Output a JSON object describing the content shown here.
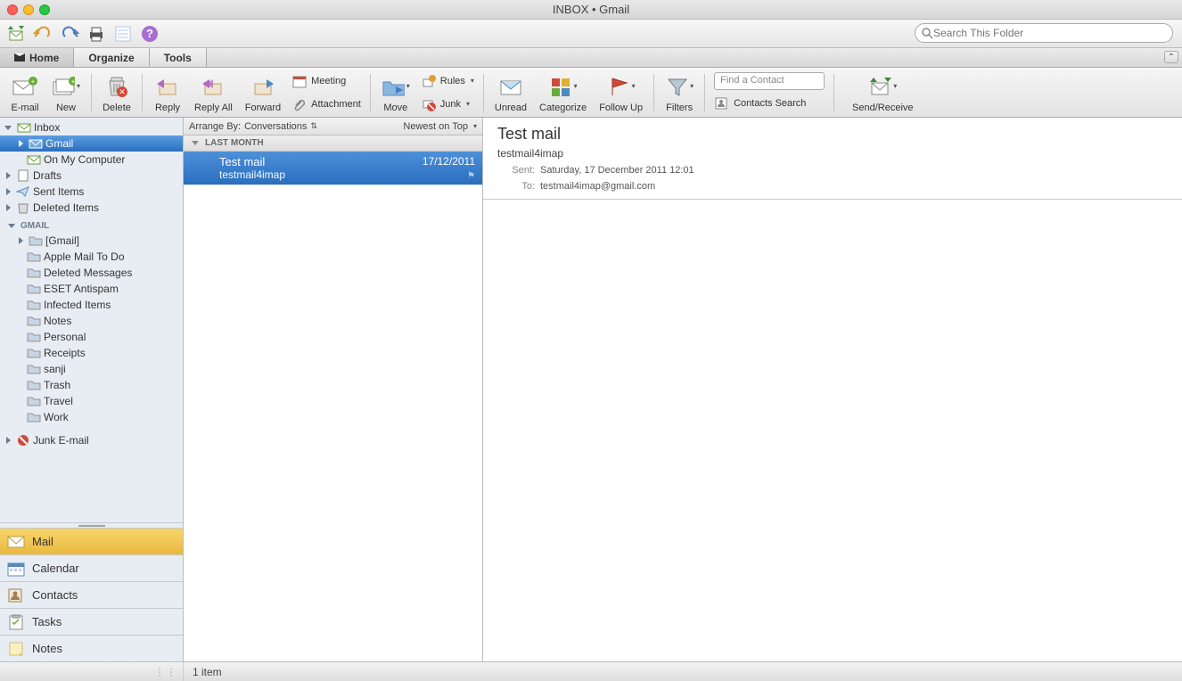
{
  "window": {
    "title": "INBOX • Gmail"
  },
  "search": {
    "placeholder": "Search This Folder"
  },
  "tabs": {
    "home": "Home",
    "organize": "Organize",
    "tools": "Tools"
  },
  "ribbon": {
    "email": "E-mail",
    "new": "New",
    "delete": "Delete",
    "reply": "Reply",
    "reply_all": "Reply All",
    "forward": "Forward",
    "meeting": "Meeting",
    "attachment": "Attachment",
    "move": "Move",
    "rules": "Rules",
    "junk": "Junk",
    "unread": "Unread",
    "categorize": "Categorize",
    "follow_up": "Follow Up",
    "filters": "Filters",
    "find_contact_placeholder": "Find a Contact",
    "contacts_search": "Contacts Search",
    "send_receive": "Send/Receive"
  },
  "sidebar": {
    "inbox": "Inbox",
    "gmail_account": "Gmail",
    "on_my_computer": "On My Computer",
    "drafts": "Drafts",
    "sent": "Sent Items",
    "deleted": "Deleted Items",
    "gmail_header": "GMAIL",
    "folders": {
      "gmail_folder": "[Gmail]",
      "apple_todo": "Apple Mail To Do",
      "deleted_messages": "Deleted Messages",
      "eset": "ESET Antispam",
      "infected": "Infected Items",
      "notes": "Notes",
      "personal": "Personal",
      "receipts": "Receipts",
      "sanji": "sanji",
      "trash": "Trash",
      "travel": "Travel",
      "work": "Work"
    },
    "junk": "Junk E-mail"
  },
  "nav": {
    "mail": "Mail",
    "calendar": "Calendar",
    "contacts": "Contacts",
    "tasks": "Tasks",
    "notes": "Notes"
  },
  "list": {
    "arrange_by_label": "Arrange By:",
    "arrange_by_value": "Conversations",
    "sort": "Newest on Top",
    "group": "LAST MONTH",
    "msg": {
      "subject": "Test mail",
      "from": "testmail4imap",
      "date": "17/12/2011"
    }
  },
  "reading": {
    "subject": "Test mail",
    "sender": "testmail4imap",
    "sent_label": "Sent:",
    "sent_value": "Saturday, 17 December 2011 12:01",
    "to_label": "To:",
    "to_value": "testmail4imap@gmail.com"
  },
  "status": {
    "count": "1 item"
  }
}
